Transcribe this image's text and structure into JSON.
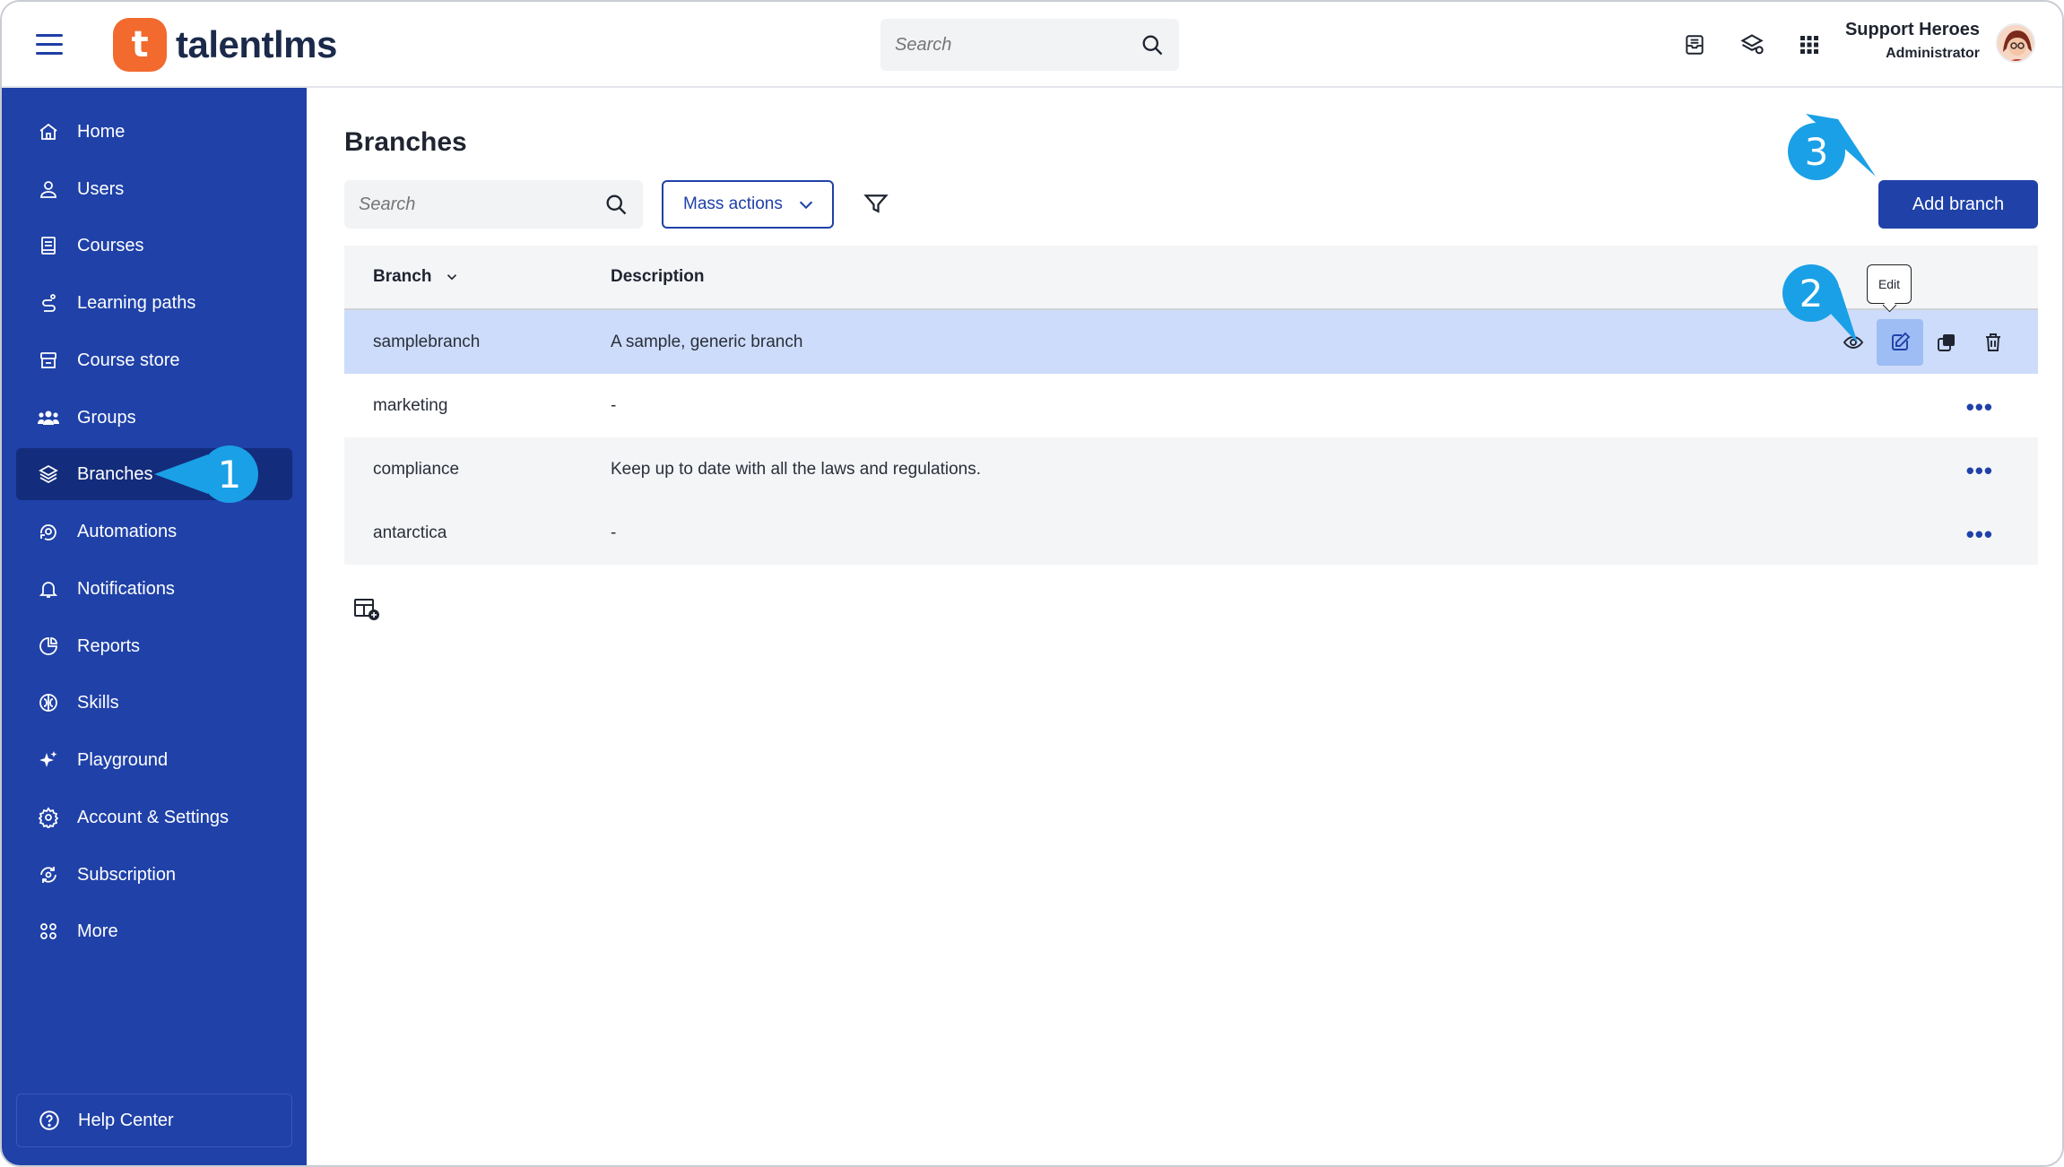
{
  "app": {
    "brand": "talentlms"
  },
  "topbar": {
    "search_placeholder": "Search",
    "user_name": "Support Heroes",
    "user_role": "Administrator"
  },
  "sidebar": {
    "items": [
      {
        "label": "Home",
        "icon": "home-icon"
      },
      {
        "label": "Users",
        "icon": "user-icon"
      },
      {
        "label": "Courses",
        "icon": "book-icon"
      },
      {
        "label": "Learning paths",
        "icon": "path-icon"
      },
      {
        "label": "Course store",
        "icon": "store-icon"
      },
      {
        "label": "Groups",
        "icon": "group-icon"
      },
      {
        "label": "Branches",
        "icon": "branches-icon",
        "active": true
      },
      {
        "label": "Automations",
        "icon": "automation-icon"
      },
      {
        "label": "Notifications",
        "icon": "bell-icon"
      },
      {
        "label": "Reports",
        "icon": "pie-chart-icon"
      },
      {
        "label": "Skills",
        "icon": "brain-icon"
      },
      {
        "label": "Playground",
        "icon": "sparkle-icon"
      },
      {
        "label": "Account & Settings",
        "icon": "gear-icon"
      },
      {
        "label": "Subscription",
        "icon": "subscription-icon"
      },
      {
        "label": "More",
        "icon": "grid-icon"
      }
    ],
    "help_label": "Help Center"
  },
  "main": {
    "title": "Branches",
    "search_placeholder": "Search",
    "mass_actions_label": "Mass actions",
    "add_branch_label": "Add branch",
    "table": {
      "columns": [
        "Branch",
        "Description"
      ],
      "rows": [
        {
          "branch": "samplebranch",
          "description": "A sample, generic branch"
        },
        {
          "branch": "marketing",
          "description": "-"
        },
        {
          "branch": "compliance",
          "description": "Keep up to date with all the laws and regulations."
        },
        {
          "branch": "antarctica",
          "description": "-"
        }
      ]
    },
    "tooltip": "Edit"
  },
  "markers": [
    "1",
    "2",
    "3"
  ],
  "colors": {
    "sidebar": "#1f41a8",
    "sidebar_active": "#132c7c",
    "accent": "#1f41a8",
    "brand_orange": "#f26a2e",
    "marker": "#1aa0e6",
    "row_highlight": "#cddcfa"
  }
}
